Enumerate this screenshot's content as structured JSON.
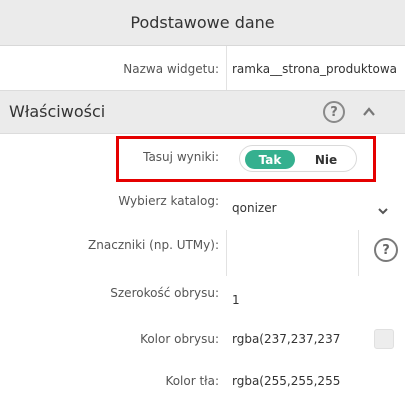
{
  "header": {
    "title": "Podstawowe dane"
  },
  "widget_name": {
    "label": "Nazwa widgetu:",
    "value": "ramka__strona_produktowa"
  },
  "section": {
    "title": "Właściwości",
    "help_glyph": "?",
    "collapse_glyph": "⌃",
    "collapse_icon": "chevron-up-icon"
  },
  "shuffle": {
    "label": "Tasuj wyniki:",
    "on_label": "Tak",
    "off_label": "Nie",
    "selected": "Tak"
  },
  "catalog": {
    "label": "Wybierz katalog:",
    "value": "qonizer",
    "dropdown_glyph": "⌄"
  },
  "tags": {
    "label": "Znaczniki (np. UTMy):",
    "value": "",
    "help_glyph": "?"
  },
  "border_width": {
    "label": "Szerokość obrysu:",
    "value": "1"
  },
  "border_color": {
    "label": "Kolor obrysu:",
    "value": "rgba(237,237,237",
    "swatch_color": "#ededed"
  },
  "bg_color": {
    "label": "Kolor tła:",
    "value": "rgba(255,255,255"
  },
  "colors": {
    "accent": "#35b08f",
    "highlight": "#e50000"
  }
}
